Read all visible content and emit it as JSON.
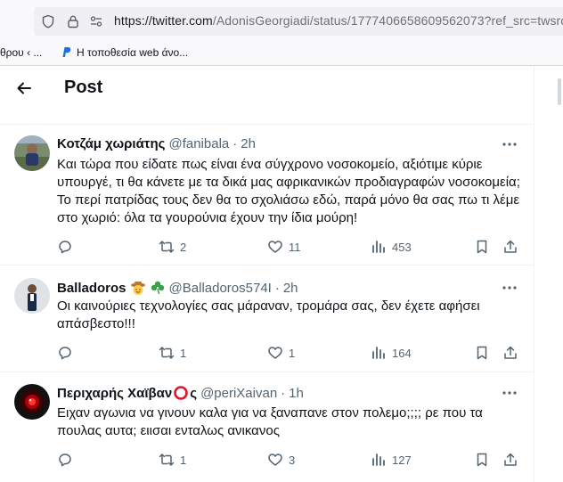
{
  "browser": {
    "url_host": "https://twitter.com",
    "url_path": "/AdonisGeorgiadi/status/1777406658609562073?ref_src=twsrc",
    "bookmarks": [
      {
        "label": "θρου ‹ ..."
      },
      {
        "label": "Η τοποθεσία web άνο..."
      }
    ],
    "colors": {
      "chrome": "#f9f9fb",
      "urlfield": "#f0f0f4",
      "bookmark_icon": "#1e6fd9"
    }
  },
  "header": {
    "back_icon": "arrow-left-icon",
    "title": "Post"
  },
  "tweets": [
    {
      "name": "Κοτζάμ χωριάτης",
      "handle": "@fanibala",
      "dot": "·",
      "time": "2h",
      "text": "Και τώρα που είδατε πως είναι ένα σύγχρονο νοσοκομείο, αξιότιμε κύριε υπουργέ, τι θα κάνετε με τα δικά μας αφρικανικών προδιαγραφών νοσοκομεία; Το περί πατρίδας τους δεν θα το σχολιάσω εδώ, παρά μόνο θα σας πω τι λέμε στο χωριό: όλα τα γουρούνια έχουν την ίδια μούρη!",
      "replies": "",
      "retweets": "2",
      "likes": "11",
      "views": "453"
    },
    {
      "name": "Balladoros",
      "name_emojis": [
        "smiling-face-with-cowboy-hat-icon",
        "shamrock-icon"
      ],
      "handle": "@Balladoros574I",
      "dot": "·",
      "time": "2h",
      "text": "Οι καινούριες τεχνολογίες σας μάραναν, τρομάρα σας, δεν έχετε αφήσει απάσβεστο!!!",
      "replies": "",
      "retweets": "1",
      "likes": "1",
      "views": "164"
    },
    {
      "name": "Περιχαρής Χαϊβαν",
      "name_emojis": [
        "red-circle-outline-icon",
        "letter-s"
      ],
      "name_suffix": "ς",
      "handle": "@periXaivan",
      "dot": "·",
      "time": "1h",
      "text": "Ειχαν αγωνια να γινουν καλα για να ξαναπανε στον πολεμο;;;; ρε που τα πουλας αυτα; ειισαι ενταλως ανικανος",
      "replies": "",
      "retweets": "1",
      "likes": "3",
      "views": "127"
    }
  ],
  "colors": {
    "text": "#0f1419",
    "secondary": "#536471",
    "border": "#eff3f4",
    "emoji_red": "#e0162b"
  }
}
